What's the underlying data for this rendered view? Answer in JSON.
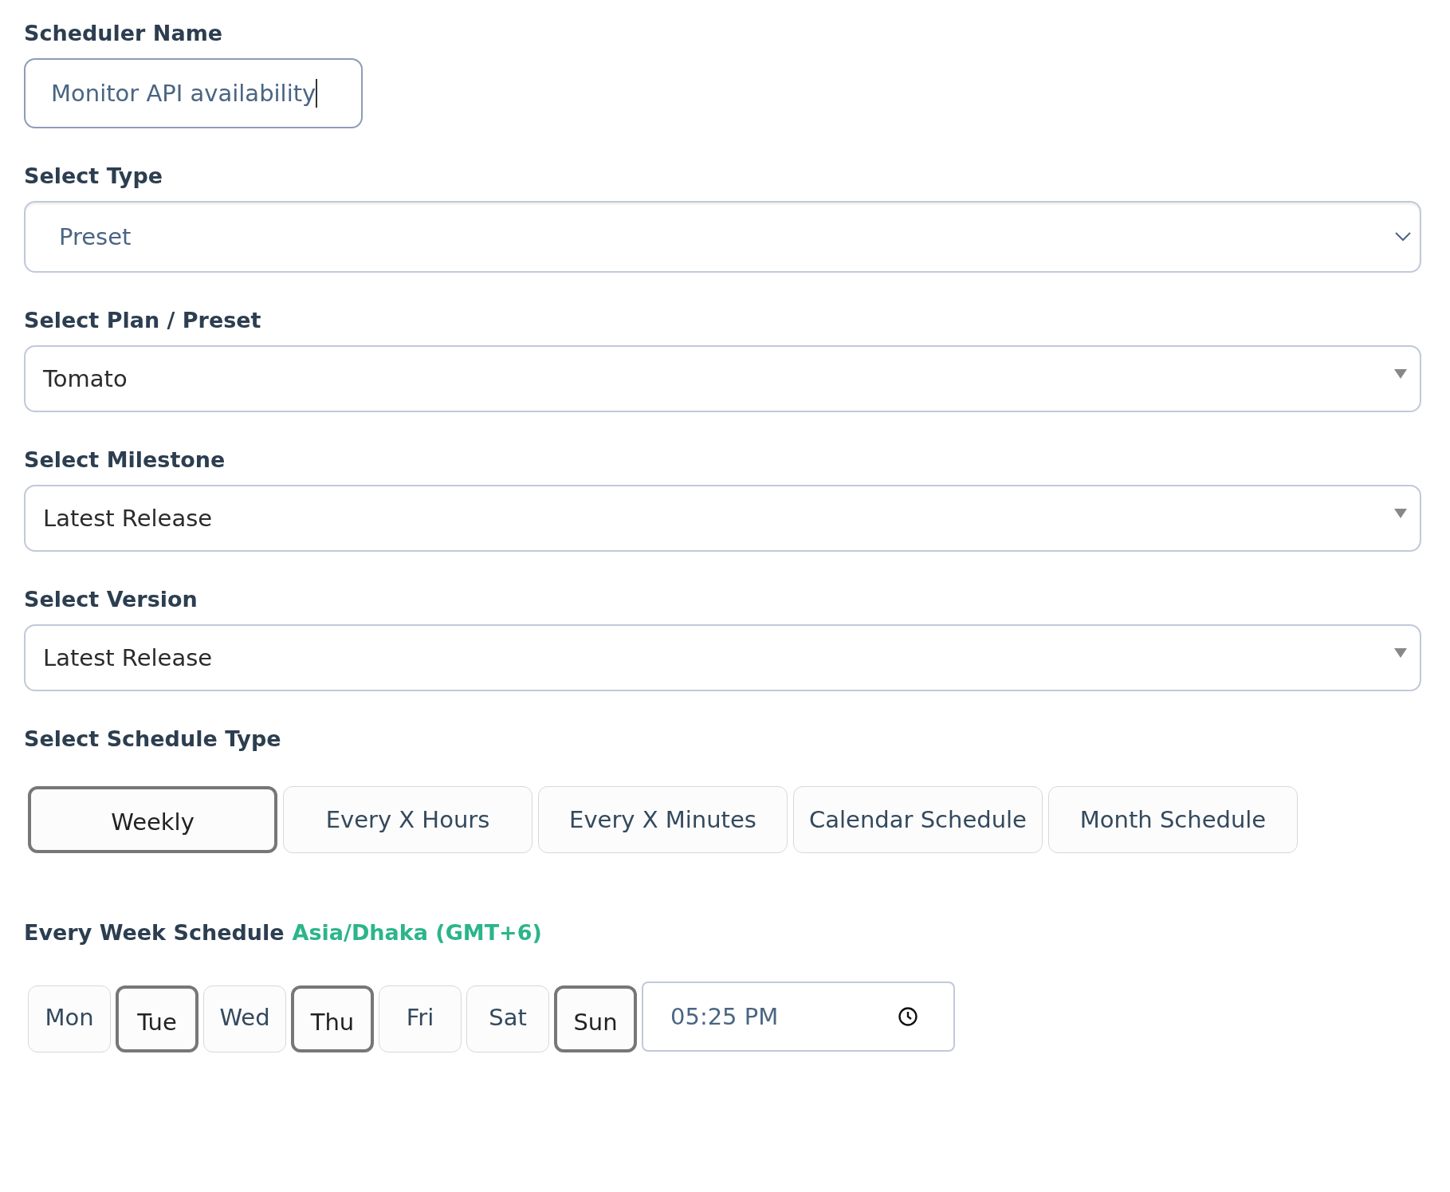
{
  "scheduler_name": {
    "label": "Scheduler Name",
    "value": "Monitor API availability"
  },
  "selects": [
    {
      "kind": "native",
      "label": "Select Type",
      "value": "Preset"
    },
    {
      "kind": "custom",
      "label": "Select Plan / Preset",
      "value": "Tomato"
    },
    {
      "kind": "custom",
      "label": "Select Milestone",
      "value": "Latest Release"
    },
    {
      "kind": "custom",
      "label": "Select Version",
      "value": "Latest Release"
    }
  ],
  "schedule_type": {
    "label": "Select Schedule Type",
    "options": [
      {
        "label": "Weekly",
        "selected": true
      },
      {
        "label": "Every X Hours",
        "selected": false
      },
      {
        "label": "Every X Minutes",
        "selected": false
      },
      {
        "label": "Calendar Schedule",
        "selected": false
      },
      {
        "label": "Month Schedule",
        "selected": false
      }
    ]
  },
  "week_schedule": {
    "label": "Every Week Schedule",
    "timezone": "Asia/Dhaka (GMT+6)",
    "days": [
      {
        "label": "Mon",
        "selected": false
      },
      {
        "label": "Tue",
        "selected": true
      },
      {
        "label": "Wed",
        "selected": false
      },
      {
        "label": "Thu",
        "selected": true
      },
      {
        "label": "Fri",
        "selected": false
      },
      {
        "label": "Sat",
        "selected": false
      },
      {
        "label": "Sun",
        "selected": true
      }
    ],
    "time": "05:25 PM"
  }
}
